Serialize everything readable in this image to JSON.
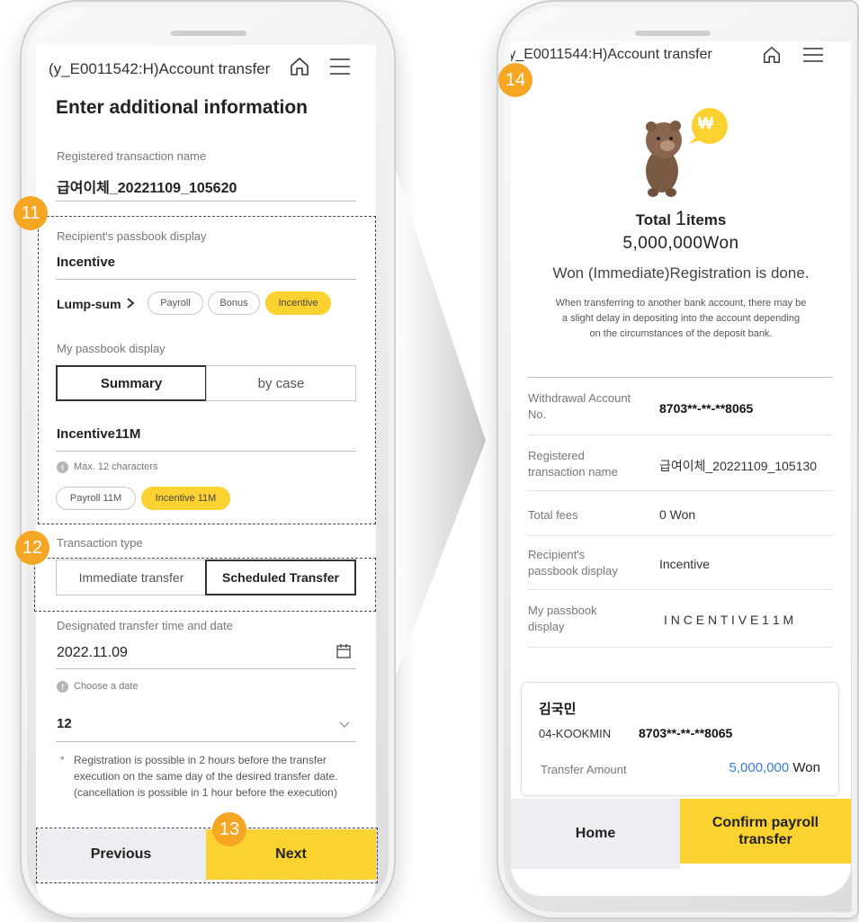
{
  "left": {
    "header_title": "(y_E0011542:H)Account transfer",
    "page_heading": "Enter additional information",
    "reg_label": "Registered transaction name",
    "reg_value": "급여이체_20221109_105620",
    "recip_label": "Recipient's passbook display",
    "recip_value": "Incentive",
    "lump_label": "Lump-sum",
    "lump_chips": [
      "Payroll",
      "Bonus",
      "Incentive"
    ],
    "my_label": "My passbook display",
    "seg_summary": "Summary",
    "seg_bycase": "by case",
    "my_value": "Incentive11M",
    "max_chars": "Max. 12 characters",
    "my_chips": [
      "Payroll 11M",
      "Incentive 11M"
    ],
    "type_label": "Transaction type",
    "type_immediate": "Immediate transfer",
    "type_scheduled": "Scheduled Transfer",
    "date_label": "Designated transfer time and date",
    "date_value": "2022.11.09",
    "choose_date": "Choose a date",
    "hour_value": "12",
    "note_star": "*",
    "note_line1": "Registration is possible in 2 hours before the transfer",
    "note_line2": "execution on the same day of the desired transfer date.",
    "note_line3": "(cancellation is possible in 1 hour before the execution)",
    "btn_previous": "Previous",
    "btn_next": "Next"
  },
  "right": {
    "header_title": "(y_E0011544:H)Account transfer",
    "coin_symbol": "₩",
    "total_prefix": "Total ",
    "total_count": "1",
    "total_suffix": "items",
    "total_amount": "5,000,000Won",
    "done_text": "Won (Immediate)Registration is done.",
    "notice1": "When transferring to another bank account, there may be",
    "notice2": "a slight delay in depositing into the account depending",
    "notice3": "on the circumstances of the deposit bank.",
    "rows": [
      {
        "label1": "Withdrawal Account",
        "label2": "No.",
        "value": "8703**-**-**8065"
      },
      {
        "label1": "Registered",
        "label2": "transaction name",
        "value": "급여이체_20221109_105130"
      },
      {
        "label1": "Total fees",
        "label2": "",
        "value": "0 Won"
      },
      {
        "label1": "Recipient's",
        "label2": "passbook display",
        "value": "Incentive"
      },
      {
        "label1": "My passbook",
        "label2": "display",
        "value": "I N C E N T I V E 1 1 M"
      }
    ],
    "card_name": "김국민",
    "card_bank": "04-KOOKMIN",
    "card_account": "8703**-**-**8065",
    "card_amount_label": "Transfer Amount",
    "card_amount": "5,000,000",
    "card_currency": "Won",
    "btn_home": "Home",
    "btn_confirm_1": "Confirm payroll",
    "btn_confirm_2": "transfer"
  },
  "badges": [
    "11",
    "12",
    "13",
    "14"
  ],
  "colors": {
    "accent_yellow": "#fcd230",
    "badge_orange": "#f5a623",
    "amount_blue": "#3a7bd5",
    "bottom_gray": "#eceef1"
  },
  "icons": [
    "home-icon",
    "menu-icon",
    "calendar-icon",
    "chevron-down-icon",
    "chevron-right-icon",
    "info-icon"
  ]
}
